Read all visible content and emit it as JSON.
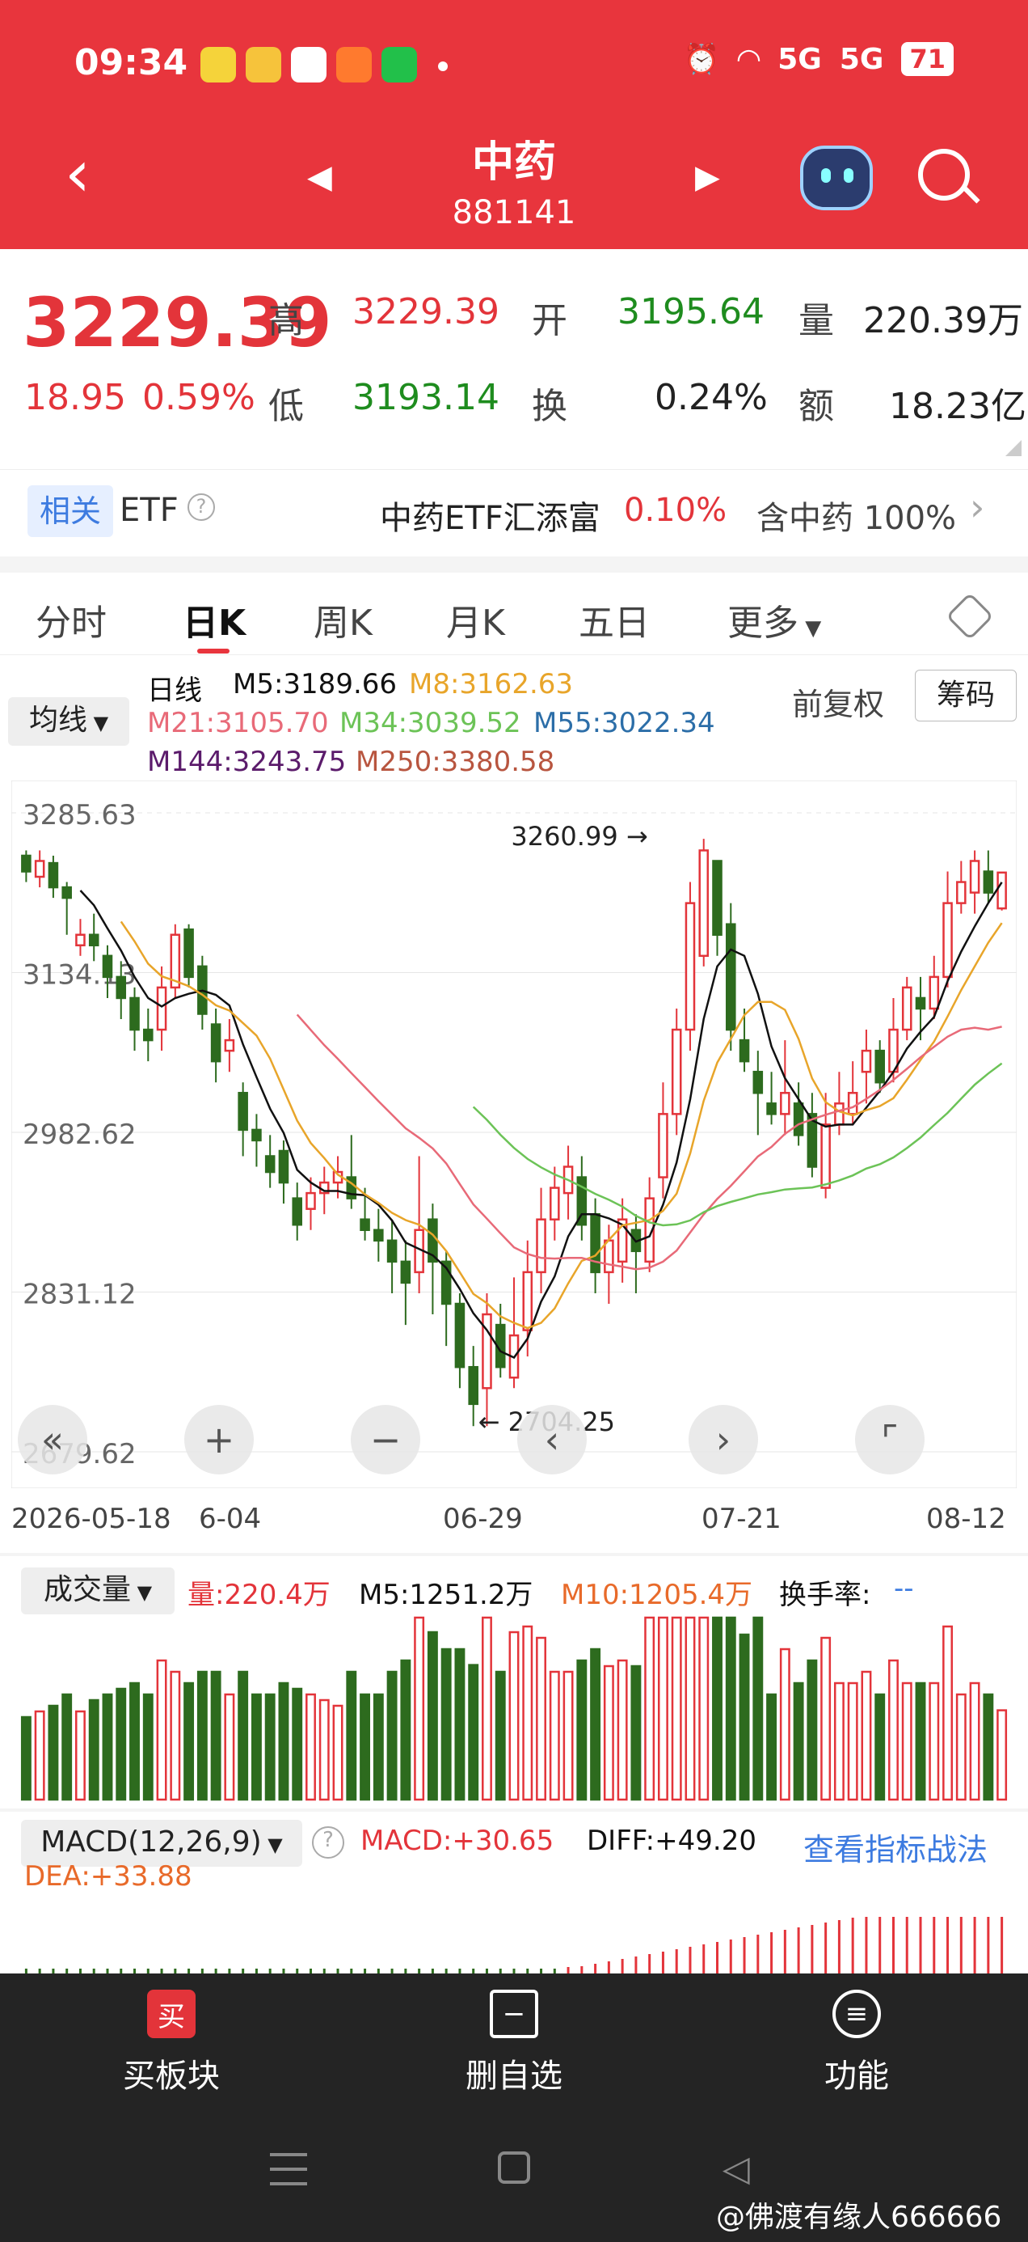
{
  "status_bar": {
    "time": "09:34",
    "battery": "71",
    "signal1": "5G",
    "signal2": "5G"
  },
  "nav": {
    "title": "中药",
    "code": "881141"
  },
  "quote": {
    "price": "3229.39",
    "change": "18.95",
    "change_pct": "0.59%",
    "high_label": "高",
    "high": "3229.39",
    "open_label": "开",
    "open": "3195.64",
    "volume_label": "量",
    "volume": "220.39万",
    "low_label": "低",
    "low": "3193.14",
    "turnover_label": "换",
    "turnover": "0.24%",
    "amount_label": "额",
    "amount": "18.23亿"
  },
  "related": {
    "tag": "相关",
    "etf": "ETF",
    "fund": "中药ETF汇添富",
    "fund_pct": "0.10%",
    "holding": "含中药 100%"
  },
  "tabs": [
    "分时",
    "日K",
    "周K",
    "月K",
    "五日",
    "更多"
  ],
  "chart_controls": {
    "ma_label": "均线",
    "adjust": "前复权",
    "chips": "筹码"
  },
  "ma_legend": {
    "day": "日线",
    "m5": "M5:3189.66",
    "m8": "M8:3162.63",
    "m21": "M21:3105.70",
    "m34": "M34:3039.52",
    "m55": "M55:3022.34",
    "m144": "M144:3243.75",
    "m250": "M250:3380.58"
  },
  "colors": {
    "up": "#e3343a",
    "down": "#2d6b1e",
    "m5": "#111111",
    "m8": "#e8a52a",
    "m21": "#e86a78",
    "m34": "#6cc357",
    "m55": "#2c6ea8",
    "m144": "#5b1b6b"
  },
  "chart_data": {
    "type": "candlestick",
    "y_ticks": [
      "3285.63",
      "3134.13",
      "2982.62",
      "2831.12",
      "2679.62"
    ],
    "x_ticks": [
      "2026-05-18",
      "6-04",
      "06-29",
      "07-21",
      "08-12"
    ],
    "annotations": [
      "3260.99",
      "2704.25"
    ],
    "ylim": [
      2679.62,
      3285.63
    ],
    "candles": [
      [
        3245,
        3230,
        3250,
        3220
      ],
      [
        3225,
        3240,
        3250,
        3215
      ],
      [
        3238,
        3215,
        3245,
        3205
      ],
      [
        3215,
        3205,
        3220,
        3170
      ],
      [
        3160,
        3170,
        3185,
        3150
      ],
      [
        3170,
        3160,
        3190,
        3145
      ],
      [
        3150,
        3130,
        3160,
        3110
      ],
      [
        3130,
        3110,
        3145,
        3090
      ],
      [
        3110,
        3080,
        3120,
        3060
      ],
      [
        3080,
        3070,
        3100,
        3050
      ],
      [
        3080,
        3120,
        3140,
        3060
      ],
      [
        3120,
        3170,
        3180,
        3110
      ],
      [
        3175,
        3130,
        3180,
        3120
      ],
      [
        3140,
        3095,
        3150,
        3080
      ],
      [
        3085,
        3050,
        3100,
        3030
      ],
      [
        3060,
        3070,
        3090,
        3040
      ],
      [
        3020,
        2985,
        3030,
        2960
      ],
      [
        2985,
        2975,
        3000,
        2950
      ],
      [
        2960,
        2945,
        2980,
        2930
      ],
      [
        2965,
        2935,
        2975,
        2915
      ],
      [
        2920,
        2895,
        2935,
        2880
      ],
      [
        2910,
        2925,
        2940,
        2890
      ],
      [
        2925,
        2935,
        2950,
        2905
      ],
      [
        2935,
        2945,
        2960,
        2920
      ],
      [
        2940,
        2920,
        2980,
        2910
      ],
      [
        2900,
        2890,
        2930,
        2880
      ],
      [
        2890,
        2880,
        2910,
        2860
      ],
      [
        2880,
        2860,
        2900,
        2830
      ],
      [
        2860,
        2840,
        2880,
        2800
      ],
      [
        2850,
        2890,
        2960,
        2830
      ],
      [
        2900,
        2860,
        2915,
        2810
      ],
      [
        2860,
        2820,
        2870,
        2780
      ],
      [
        2820,
        2760,
        2830,
        2740
      ],
      [
        2760,
        2725,
        2780,
        2704
      ],
      [
        2740,
        2810,
        2830,
        2704
      ],
      [
        2800,
        2760,
        2820,
        2750
      ],
      [
        2750,
        2790,
        2845,
        2740
      ],
      [
        2795,
        2850,
        2880,
        2770
      ],
      [
        2850,
        2900,
        2930,
        2830
      ],
      [
        2900,
        2930,
        2950,
        2880
      ],
      [
        2925,
        2950,
        2970,
        2900
      ],
      [
        2940,
        2895,
        2960,
        2880
      ],
      [
        2905,
        2850,
        2920,
        2830
      ],
      [
        2850,
        2880,
        2895,
        2820
      ],
      [
        2860,
        2900,
        2920,
        2840
      ],
      [
        2890,
        2870,
        2905,
        2830
      ],
      [
        2860,
        2920,
        2940,
        2850
      ],
      [
        2940,
        3000,
        3030,
        2920
      ],
      [
        3000,
        3080,
        3100,
        2980
      ],
      [
        3080,
        3200,
        3220,
        3060
      ],
      [
        3150,
        3250,
        3261,
        3140
      ],
      [
        3240,
        3170,
        3240,
        3150
      ],
      [
        3180,
        3080,
        3200,
        3060
      ],
      [
        3070,
        3050,
        3100,
        3040
      ],
      [
        3040,
        3020,
        3060,
        2980
      ],
      [
        3010,
        3000,
        3040,
        2990
      ],
      [
        3000,
        3020,
        3070,
        2980
      ],
      [
        3010,
        2980,
        3030,
        2970
      ],
      [
        3000,
        2950,
        3020,
        2940
      ],
      [
        2930,
        2990,
        3020,
        2920
      ],
      [
        2990,
        3010,
        3040,
        2980
      ],
      [
        3000,
        3020,
        3050,
        2990
      ],
      [
        3040,
        3060,
        3080,
        3010
      ],
      [
        3060,
        3030,
        3070,
        3020
      ],
      [
        3040,
        3080,
        3110,
        3030
      ],
      [
        3080,
        3120,
        3130,
        3070
      ],
      [
        3110,
        3100,
        3130,
        3070
      ],
      [
        3100,
        3130,
        3150,
        3090
      ],
      [
        3130,
        3200,
        3230,
        3120
      ],
      [
        3200,
        3220,
        3240,
        3190
      ],
      [
        3210,
        3240,
        3250,
        3190
      ],
      [
        3230,
        3210,
        3250,
        3200
      ],
      [
        3195,
        3229,
        3229,
        3193
      ]
    ]
  },
  "volume_panel": {
    "label": "成交量",
    "vol": "量:220.4万",
    "m5": "M5:1251.2万",
    "m10": "M10:1205.4万",
    "turnover": "换手率:",
    "turnover_val": "--"
  },
  "macd_panel": {
    "label": "MACD(12,26,9)",
    "macd": "MACD:+30.65",
    "diff": "DIFF:+49.20",
    "dea": "DEA:+33.88",
    "link": "查看指标战法"
  },
  "bottom_bar": {
    "buy": "买板块",
    "buy_icon": "买",
    "remove": "删自选",
    "func": "功能"
  },
  "watermark": "@佛渡有缘人666666"
}
